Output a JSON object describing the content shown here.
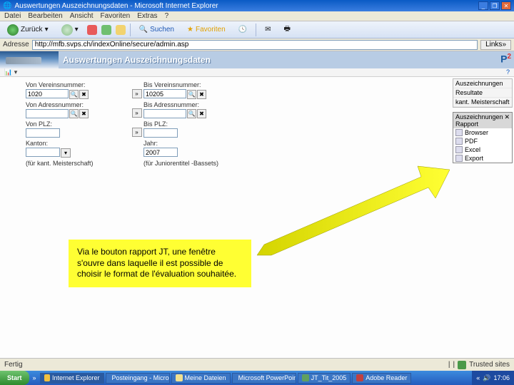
{
  "ie": {
    "title": "Auswertungen Auszeichnungsdaten - Microsoft Internet Explorer",
    "menu": [
      "Datei",
      "Bearbeiten",
      "Ansicht",
      "Favoriten",
      "Extras",
      "?"
    ],
    "toolbar": {
      "back": "Zurück",
      "search": "Suchen",
      "fav": "Favoriten"
    },
    "addr_label": "Adresse",
    "address": "http://mfb.svps.ch/indexOnline/secure/admin.asp",
    "links": "Links",
    "status_left": "Fertig",
    "status_right": "Trusted sites"
  },
  "app": {
    "title": "Auswertungen Auszeichnungsdaten",
    "logo": "P2",
    "help": "?"
  },
  "form": {
    "von_verein_lbl": "Von Vereinsnummer:",
    "von_verein_val": "1020",
    "bis_verein_lbl": "Bis Vereinsnummer:",
    "bis_verein_val": "10205",
    "von_adr_lbl": "Von Adressnummer:",
    "von_adr_val": "",
    "bis_adr_lbl": "Bis Adressnummer:",
    "bis_adr_val": "",
    "von_plz_lbl": "Von PLZ:",
    "von_plz_val": "",
    "bis_plz_lbl": "Bis PLZ:",
    "bis_plz_val": "",
    "kanton_lbl": "Kanton:",
    "kanton_val": "",
    "jahr_lbl": "Jahr:",
    "jahr_val": "2007",
    "meister_lbl": "(für kant. Meisterschaft)",
    "junior_lbl": "(für Juniorentitel -Bassets)"
  },
  "sidebar": {
    "list": [
      "Auszeichnungen",
      "Resultate",
      "kant. Meisterschaft"
    ],
    "panel_hdr": "Auszeichnungen Rapport",
    "panel_items": [
      "Browser",
      "PDF",
      "Excel",
      "Export"
    ]
  },
  "callout": "Via le bouton rapport JT, une fenêtre s'ouvre dans laquelle il est possible de choisir le format de l'évaluation souhaitée.",
  "taskbar": {
    "start": "Start",
    "items": [
      "Internet Explorer",
      "Posteingang - Micros...",
      "Meine Dateien",
      "Microsoft PowerPoint",
      "JT_Tit_2005",
      "Adobe Reader"
    ],
    "time": "17:06"
  }
}
